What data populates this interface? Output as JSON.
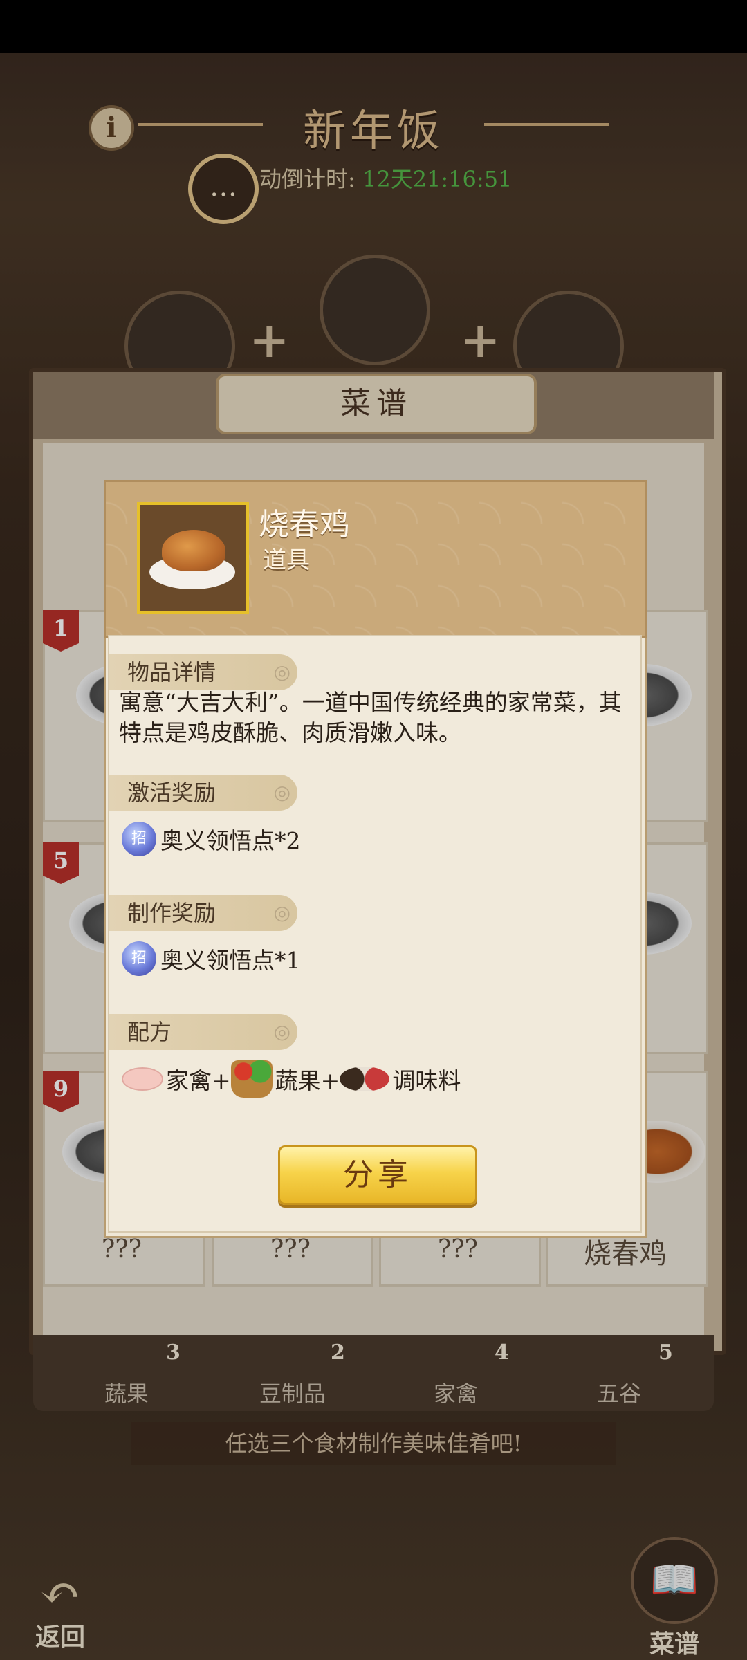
{
  "header": {
    "title": "新年饭",
    "countdown_label": "动倒计时:",
    "countdown_value": "12天21:16:51"
  },
  "recipe_panel": {
    "title": "菜谱",
    "cards": [
      {
        "badge": "1"
      },
      {
        "badge": "5"
      },
      {
        "badge": "9",
        "label": "???"
      },
      {
        "label": "???"
      },
      {
        "label": "???"
      },
      {
        "label": "烧春鸡"
      }
    ]
  },
  "categories": [
    {
      "label": "蔬果",
      "count": "3"
    },
    {
      "label": "豆制品",
      "count": "2"
    },
    {
      "label": "家禽",
      "count": "4"
    },
    {
      "label": "五谷",
      "count": "5"
    }
  ],
  "hint": "任选三个食材制作美味佳肴吧!",
  "nav": {
    "back_label": "返回",
    "recipe_book_label": "菜谱"
  },
  "item_modal": {
    "name": "烧春鸡",
    "type": "道具",
    "details_heading": "物品详情",
    "description": "寓意“大吉大利”。一道中国传统经典的家常菜，其特点是鸡皮酥脆、肉质滑嫩入味。",
    "activation_heading": "激活奖励",
    "activation_reward": "奥义领悟点*2",
    "crafting_heading": "制作奖励",
    "crafting_reward": "奥义领悟点*1",
    "orb_glyph": "招",
    "recipe_heading": "配方",
    "recipe_parts": [
      "家禽+",
      "蔬果+",
      "调味料"
    ],
    "share_label": "分享"
  }
}
